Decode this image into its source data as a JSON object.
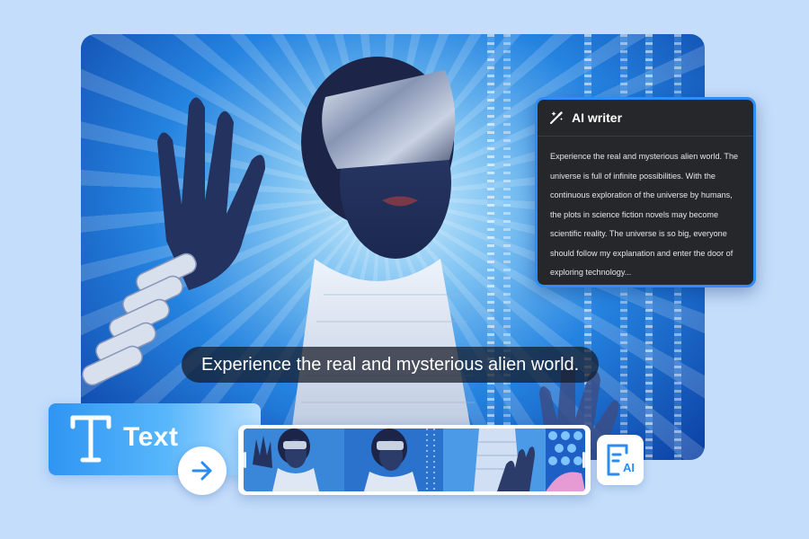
{
  "preview": {
    "subtitle_text": "Experience the real and mysterious alien world."
  },
  "ai_writer": {
    "icon": "magic-wand-icon",
    "title": "AI writer",
    "body": "Experience the real and mysterious alien world. The universe is full of infinite possibilities. With the continuous exploration of the universe by humans, the plots in science fiction novels may become scientific reality. The universe is so big, everyone should follow my explanation and enter the door of exploring technology..."
  },
  "text_tool": {
    "icon": "text-t-icon",
    "label": "Text",
    "action_icon": "arrow-right-icon"
  },
  "filmstrip": {
    "frame_count": 4
  },
  "ai_doc": {
    "icon": "ai-document-icon",
    "label": "AI"
  },
  "colors": {
    "background": "#c4ddfb",
    "accent": "#2f8df5",
    "panel": "#26272b",
    "caption_bg": "#14182480"
  }
}
